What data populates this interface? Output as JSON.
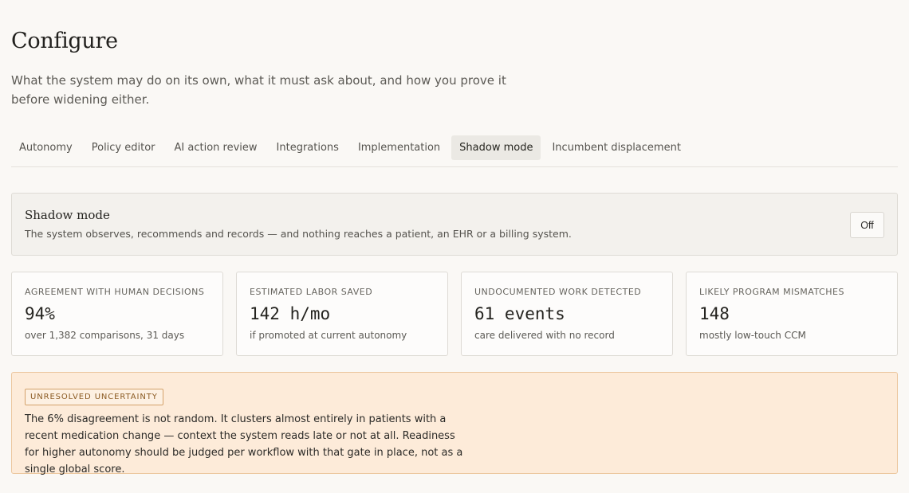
{
  "header": {
    "title": "Configure",
    "subtitle": "What the system may do on its own, what it must ask about, and how you prove it before widening either."
  },
  "tabs": [
    {
      "label": "Autonomy"
    },
    {
      "label": "Policy editor"
    },
    {
      "label": "AI action review"
    },
    {
      "label": "Integrations"
    },
    {
      "label": "Implementation"
    },
    {
      "label": "Shadow mode",
      "active": true
    },
    {
      "label": "Incumbent displacement"
    }
  ],
  "shadow_mode": {
    "title": "Shadow mode",
    "description": "The system observes, recommends and records — and nothing reaches a patient, an EHR or a billing system.",
    "toggle_label": "Off"
  },
  "metrics": [
    {
      "label": "Agreement with human decisions",
      "value": "94%",
      "note": "over 1,382 comparisons, 31 days"
    },
    {
      "label": "Estimated labor saved",
      "value": "142 h/mo",
      "note": "if promoted at current autonomy"
    },
    {
      "label": "Undocumented work detected",
      "value": "61 events",
      "note": "care delivered with no record"
    },
    {
      "label": "Likely program mismatches",
      "value": "148",
      "note": "mostly low-touch CCM"
    }
  ],
  "uncertainty": {
    "badge": "Unresolved uncertainty",
    "text": "The 6% disagreement is not random. It clusters almost entirely in patients with a recent medication change — context the system reads late or not at all. Readiness for higher autonomy should be judged per workflow with that gate in place, not as a single global score."
  }
}
